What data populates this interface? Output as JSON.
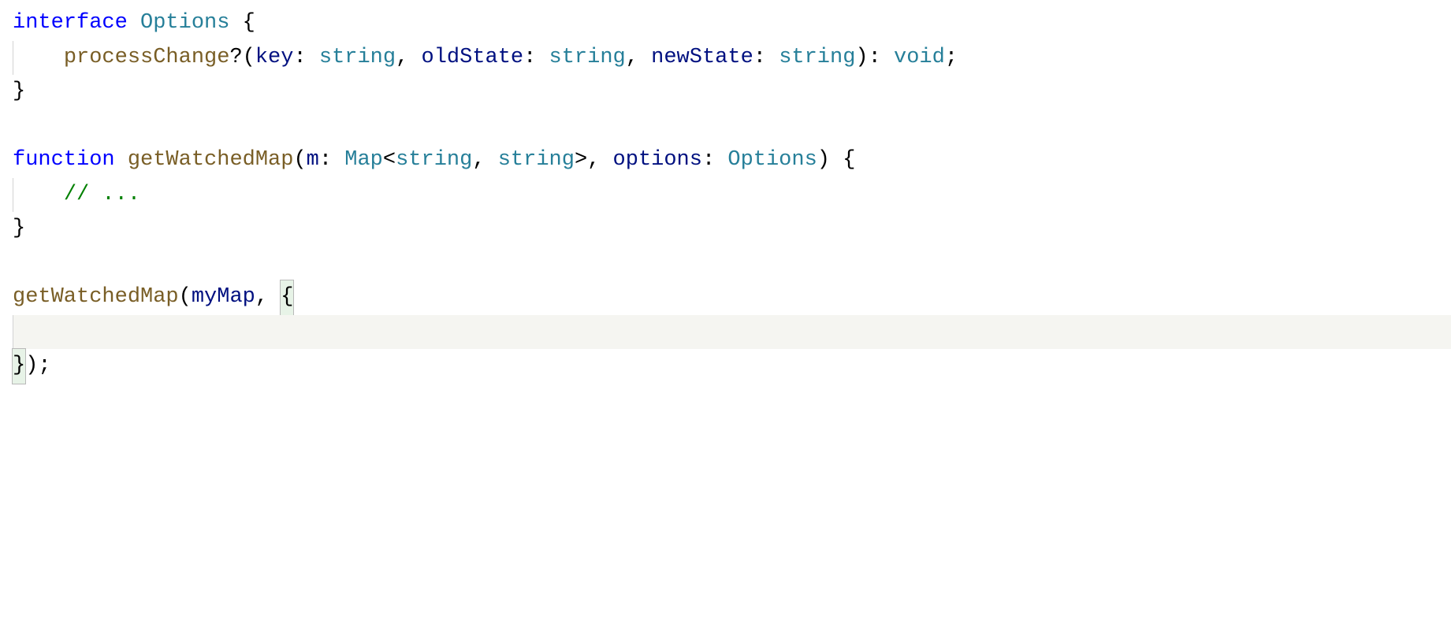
{
  "code": {
    "lines": [
      {
        "segments": [
          {
            "cls": "kw",
            "text": "interface"
          },
          {
            "cls": "",
            "text": " "
          },
          {
            "cls": "type",
            "text": "Options"
          },
          {
            "cls": "",
            "text": " "
          },
          {
            "cls": "punct",
            "text": "{"
          }
        ],
        "current": false,
        "indent": 0
      },
      {
        "segments": [
          {
            "cls": "fn",
            "text": "processChange"
          },
          {
            "cls": "punct",
            "text": "?("
          },
          {
            "cls": "param",
            "text": "key"
          },
          {
            "cls": "punct",
            "text": ": "
          },
          {
            "cls": "type",
            "text": "string"
          },
          {
            "cls": "punct",
            "text": ", "
          },
          {
            "cls": "param",
            "text": "oldState"
          },
          {
            "cls": "punct",
            "text": ": "
          },
          {
            "cls": "type",
            "text": "string"
          },
          {
            "cls": "punct",
            "text": ", "
          },
          {
            "cls": "param",
            "text": "newState"
          },
          {
            "cls": "punct",
            "text": ": "
          },
          {
            "cls": "type",
            "text": "string"
          },
          {
            "cls": "punct",
            "text": "): "
          },
          {
            "cls": "type",
            "text": "void"
          },
          {
            "cls": "punct",
            "text": ";"
          }
        ],
        "current": false,
        "indent": 1
      },
      {
        "segments": [
          {
            "cls": "punct",
            "text": "}"
          }
        ],
        "current": false,
        "indent": 0
      },
      {
        "segments": [],
        "current": false,
        "indent": 0
      },
      {
        "segments": [
          {
            "cls": "kw",
            "text": "function"
          },
          {
            "cls": "",
            "text": " "
          },
          {
            "cls": "fn",
            "text": "getWatchedMap"
          },
          {
            "cls": "punct",
            "text": "("
          },
          {
            "cls": "param",
            "text": "m"
          },
          {
            "cls": "punct",
            "text": ": "
          },
          {
            "cls": "type",
            "text": "Map"
          },
          {
            "cls": "punct",
            "text": "<"
          },
          {
            "cls": "type",
            "text": "string"
          },
          {
            "cls": "punct",
            "text": ", "
          },
          {
            "cls": "type",
            "text": "string"
          },
          {
            "cls": "punct",
            "text": ">, "
          },
          {
            "cls": "param",
            "text": "options"
          },
          {
            "cls": "punct",
            "text": ": "
          },
          {
            "cls": "type",
            "text": "Options"
          },
          {
            "cls": "punct",
            "text": ") {"
          }
        ],
        "current": false,
        "indent": 0
      },
      {
        "segments": [
          {
            "cls": "comment",
            "text": "// ..."
          }
        ],
        "current": false,
        "indent": 1
      },
      {
        "segments": [
          {
            "cls": "punct",
            "text": "}"
          }
        ],
        "current": false,
        "indent": 0
      },
      {
        "segments": [],
        "current": false,
        "indent": 0
      },
      {
        "segments": [
          {
            "cls": "fn",
            "text": "getWatchedMap"
          },
          {
            "cls": "punct",
            "text": "("
          },
          {
            "cls": "param",
            "text": "myMap"
          },
          {
            "cls": "punct",
            "text": ", "
          },
          {
            "cls": "punct brace-match",
            "text": "{"
          }
        ],
        "current": false,
        "indent": 0
      },
      {
        "segments": [],
        "current": true,
        "indent": 1
      },
      {
        "segments": [
          {
            "cls": "punct brace-match",
            "text": "}"
          },
          {
            "cls": "punct",
            "text": ");"
          }
        ],
        "current": false,
        "indent": 0
      }
    ]
  }
}
